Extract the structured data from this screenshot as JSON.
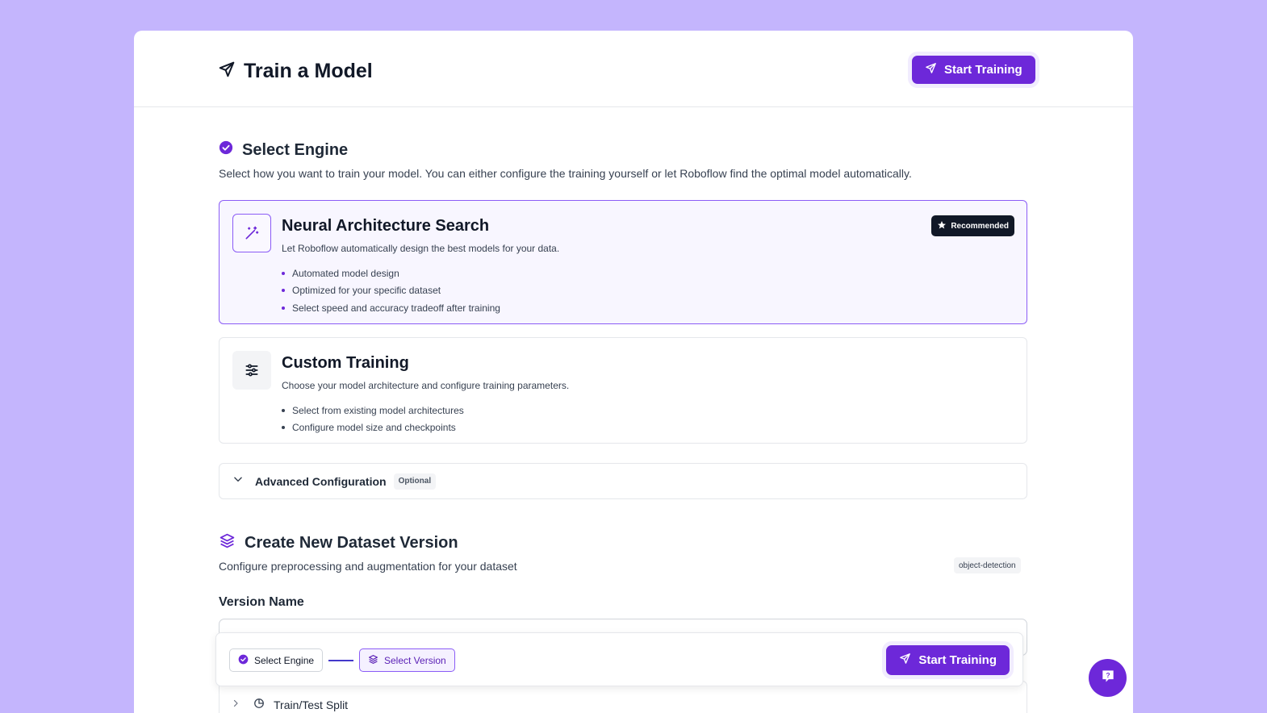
{
  "header": {
    "title": "Train a Model",
    "start_training": "Start Training"
  },
  "engine": {
    "title": "Select Engine",
    "description": "Select how you want to train your model. You can either configure the training yourself or let Roboflow find the optimal model automatically.",
    "options": [
      {
        "title": "Neural Architecture Search",
        "description": "Let Roboflow automatically design the best models for your data.",
        "badge": "Recommended",
        "features": [
          "Automated model design",
          "Optimized for your specific dataset",
          "Select speed and accuracy tradeoff after training"
        ],
        "selected": true
      },
      {
        "title": "Custom Training",
        "description": "Choose your model architecture and configure training parameters.",
        "features": [
          "Select from existing model architectures",
          "Configure model size and checkpoints"
        ],
        "selected": false
      }
    ]
  },
  "advanced": {
    "label": "Advanced Configuration",
    "chip": "Optional"
  },
  "dataset": {
    "title": "Create New Dataset Version",
    "description": "Configure preprocessing and augmentation for your dataset",
    "project_type": "object-detection",
    "version_name_label": "Version Name",
    "version_name_value": "",
    "split_label": "Train/Test Split"
  },
  "stepper": {
    "step1": "Select Engine",
    "step2": "Select Version",
    "start_training": "Start Training"
  },
  "colors": {
    "accent": "#6d28d9",
    "background": "#c4b5fd"
  }
}
